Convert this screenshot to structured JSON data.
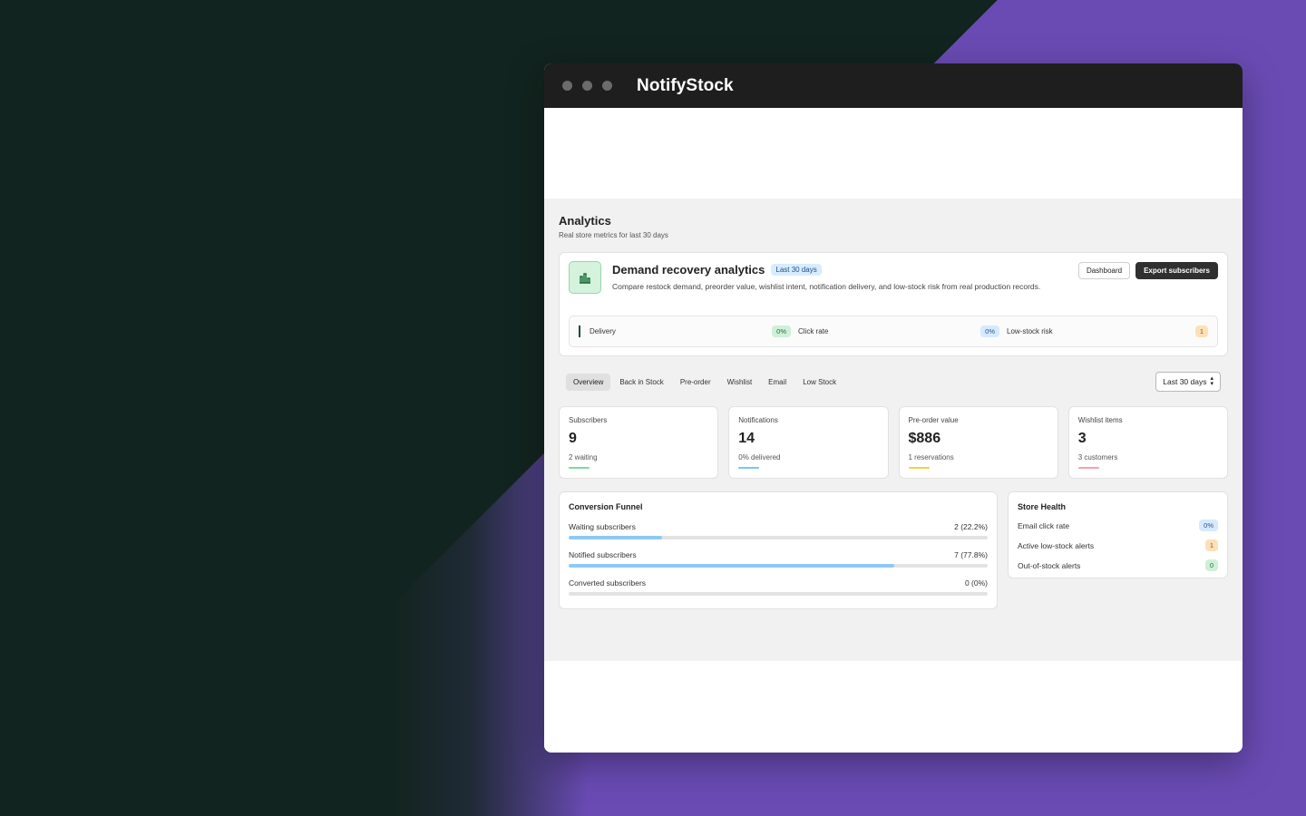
{
  "app": {
    "title": "NotifyStock"
  },
  "page": {
    "title": "Analytics",
    "subtitle": "Real store metrics for last 30 days"
  },
  "hero": {
    "icon": "building-chart-icon",
    "title": "Demand recovery analytics",
    "badge": "Last 30 days",
    "description": "Compare restock demand, preorder value, wishlist intent, notification delivery, and low-stock risk from real production records.",
    "dashboard_label": "Dashboard",
    "export_label": "Export subscribers",
    "metrics": [
      {
        "label": "Delivery",
        "value": "0%"
      },
      {
        "label": "Click rate",
        "value": "0%"
      },
      {
        "label": "Low-stock risk",
        "value": "1"
      }
    ]
  },
  "tabs": [
    "Overview",
    "Back in Stock",
    "Pre-order",
    "Wishlist",
    "Email",
    "Low Stock"
  ],
  "range_select": {
    "value": "Last 30 days"
  },
  "stats": [
    {
      "label": "Subscribers",
      "value": "9",
      "sub": "2 waiting",
      "color": "#7fd9a0"
    },
    {
      "label": "Notifications",
      "value": "14",
      "sub": "0% delivered",
      "color": "#7cc4f0"
    },
    {
      "label": "Pre-order value",
      "value": "$886",
      "sub": "1 reservations",
      "color": "#f4cf4a"
    },
    {
      "label": "Wishlist items",
      "value": "3",
      "sub": "3 customers",
      "color": "#f2a3ad"
    }
  ],
  "funnel": {
    "title": "Conversion Funnel",
    "rows": [
      {
        "label": "Waiting subscribers",
        "value": "2 (22.2%)",
        "percent": 22.2
      },
      {
        "label": "Notified subscribers",
        "value": "7 (77.8%)",
        "percent": 77.8
      },
      {
        "label": "Converted subscribers",
        "value": "0 (0%)",
        "percent": 0
      }
    ]
  },
  "health": {
    "title": "Store Health",
    "rows": [
      {
        "label": "Email click rate",
        "value": "0%"
      },
      {
        "label": "Active low-stock alerts",
        "value": "1"
      },
      {
        "label": "Out-of-stock alerts",
        "value": "0"
      }
    ]
  }
}
